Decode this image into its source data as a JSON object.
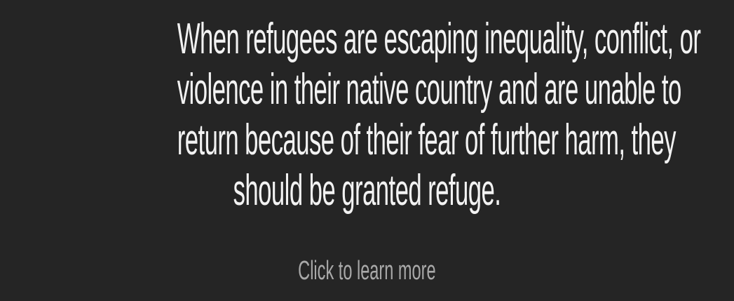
{
  "quote": {
    "lines": [
      "When refugees are escaping inequality, conflict, or",
      "violence in their native country and are unable to",
      "return because of their fear of further harm, they",
      "should be granted refuge."
    ]
  },
  "cta": {
    "label": "Click to learn more"
  },
  "colors": {
    "background": "#252525",
    "quote_text": "#f2f2f2",
    "cta_text": "#a9a9a9"
  }
}
